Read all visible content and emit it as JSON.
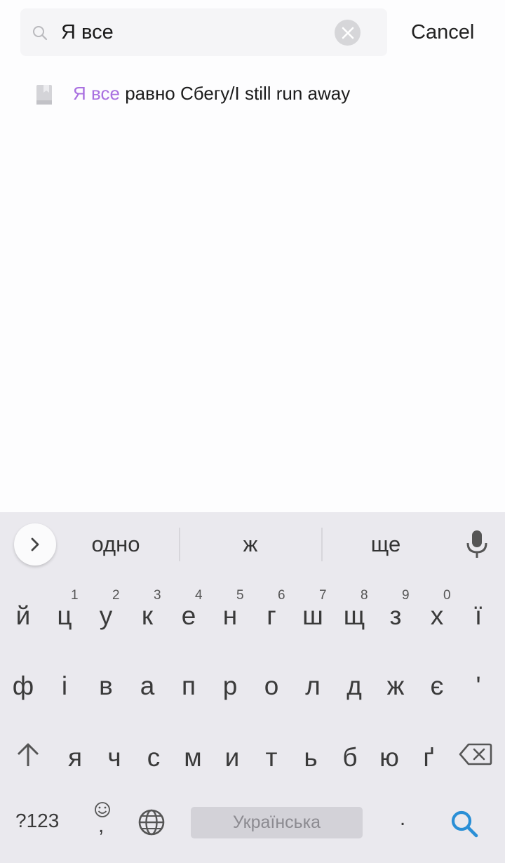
{
  "search": {
    "query": "Я все",
    "cancel_label": "Cancel"
  },
  "results": [
    {
      "icon": "book-icon",
      "highlight": "Я все",
      "rest": " равно Сбегу/I still run away"
    }
  ],
  "keyboard": {
    "suggestions": [
      "одно",
      "ж",
      "ще"
    ],
    "row1": [
      {
        "char": "й",
        "hint": ""
      },
      {
        "char": "ц",
        "hint": "1"
      },
      {
        "char": "у",
        "hint": "2"
      },
      {
        "char": "к",
        "hint": "3"
      },
      {
        "char": "е",
        "hint": "4"
      },
      {
        "char": "н",
        "hint": "5"
      },
      {
        "char": "г",
        "hint": "6"
      },
      {
        "char": "ш",
        "hint": "7"
      },
      {
        "char": "щ",
        "hint": "8"
      },
      {
        "char": "з",
        "hint": "9"
      },
      {
        "char": "х",
        "hint": "0"
      },
      {
        "char": "ї",
        "hint": ""
      }
    ],
    "row2": [
      "ф",
      "і",
      "в",
      "а",
      "п",
      "р",
      "о",
      "л",
      "д",
      "ж",
      "є",
      "'"
    ],
    "row3": [
      "я",
      "ч",
      "с",
      "м",
      "и",
      "т",
      "ь",
      "б",
      "ю",
      "ґ"
    ],
    "symbols_label": "?123",
    "emoji_comma": ",",
    "space_label": "Українська",
    "period_label": ".",
    "accent_color": "#2a8fd6"
  },
  "colors": {
    "highlight": "#a970e0",
    "keyboard_bg": "#eae9ee"
  }
}
